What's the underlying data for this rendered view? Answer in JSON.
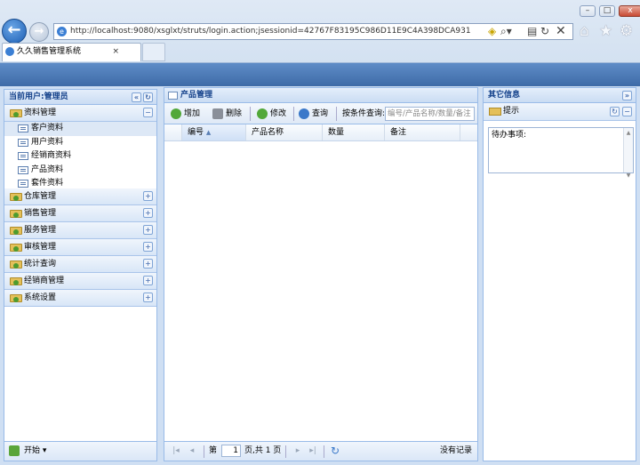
{
  "browser": {
    "url": "http://localhost:9080/xsglxt/struts/login.action;jsessionid=42767F83195C986D11E9C4A398DCA931",
    "tab_title": "久久销售管理系统",
    "tab_close": "×"
  },
  "west": {
    "title": "当前用户:管理员",
    "sections": [
      {
        "label": "资料管理",
        "expanded": true,
        "items": [
          "客户资料",
          "用户资料",
          "经销商资料",
          "产品资料",
          "套件资料"
        ]
      },
      {
        "label": "仓库管理"
      },
      {
        "label": "销售管理"
      },
      {
        "label": "服务管理"
      },
      {
        "label": "审核管理"
      },
      {
        "label": "统计查询"
      },
      {
        "label": "经销商管理"
      },
      {
        "label": "系统设置"
      }
    ],
    "start_label": "开始 ▾"
  },
  "center": {
    "title": "产品管理",
    "toolbar": {
      "add": "增加",
      "delete": "删除",
      "edit": "修改",
      "query": "查询",
      "search_label": "按条件查询:",
      "search_placeholder": "编号/产品名称/数量/备注"
    },
    "columns": [
      "编号",
      "产品名称",
      "数量",
      "备注"
    ],
    "pager": {
      "page_prefix": "第",
      "page_value": "1",
      "page_suffix": "页,共 1 页",
      "status": "没有记录"
    }
  },
  "east": {
    "title": "其它信息",
    "sub_title": "提示",
    "todo_text": "待办事项:"
  },
  "colors": {
    "panel_border": "#99bbe8",
    "header_text": "#15428b",
    "banner": "#4a76b2"
  }
}
